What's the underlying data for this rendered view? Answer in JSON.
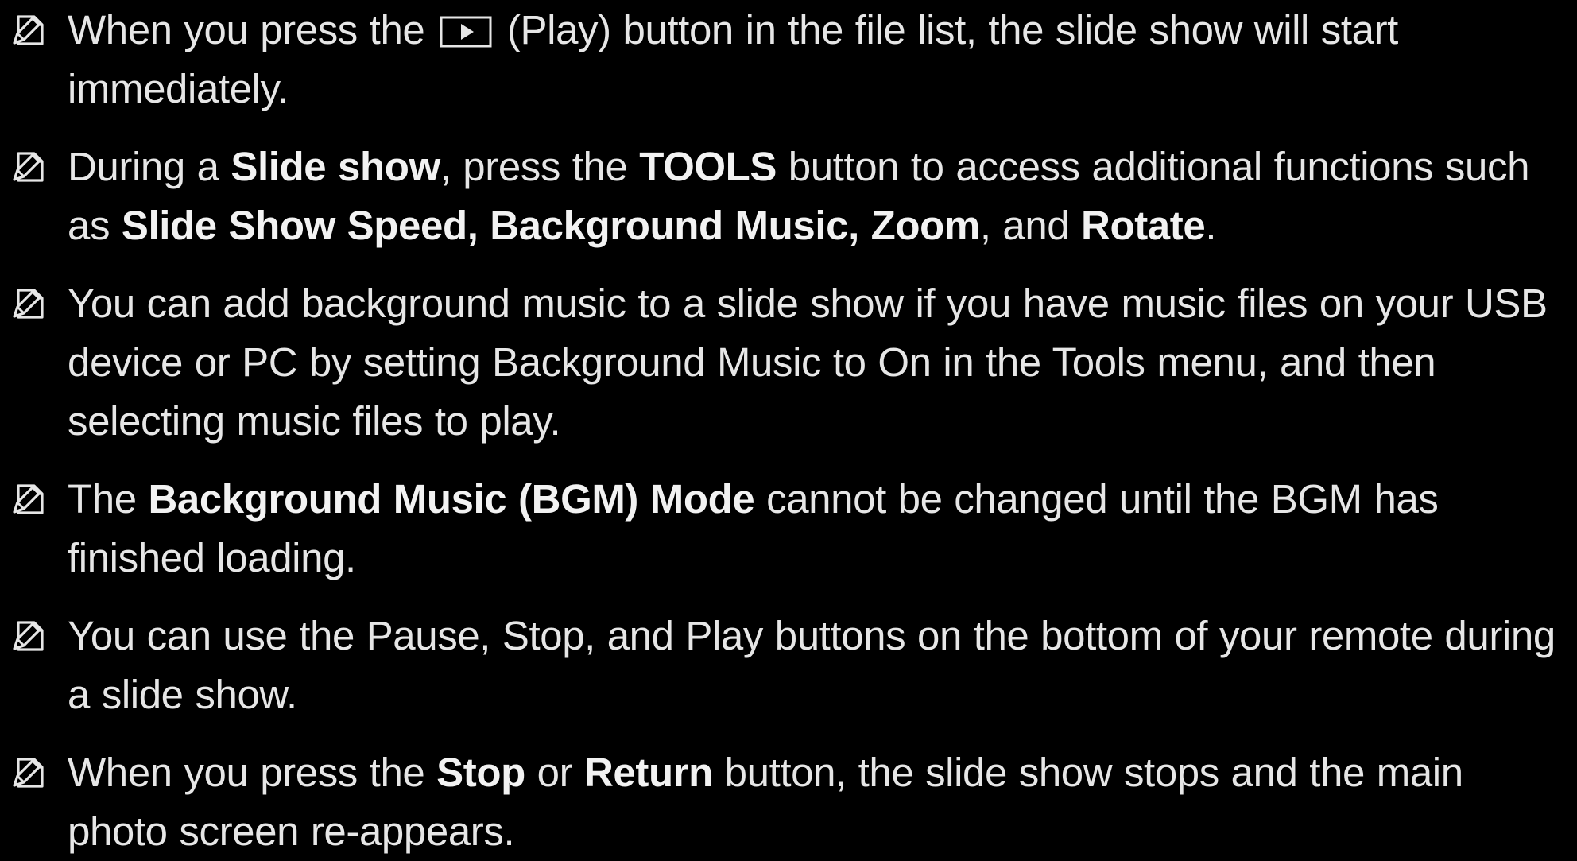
{
  "icons": {
    "note": "note-icon",
    "play": "play-button-icon"
  },
  "colors": {
    "background": "#000000",
    "text": "#e6e6e6"
  },
  "notes": [
    {
      "before_icon": "When you press the",
      "after_icon": "(Play) button in the file list, the slide show will start immediately."
    },
    {
      "t1": "During a ",
      "b1": "Slide show",
      "t2": ", press the ",
      "b2": "TOOLS",
      "t3": " button to access additional functions such as ",
      "b3": "Slide Show Speed, Background Music, Zoom",
      "t4": ", and ",
      "b4": "Rotate",
      "t5": "."
    },
    {
      "text": "You can add background music to a slide show if you have music files on your USB device or PC by setting Background Music to On in the Tools menu, and then selecting music files to play."
    },
    {
      "t1": "The ",
      "b1": "Background Music (BGM) Mode",
      "t2": " cannot be changed until the BGM has finished loading."
    },
    {
      "text": "You can use the Pause, Stop, and Play buttons on the bottom of your remote during a slide show."
    },
    {
      "t1": "When you press the ",
      "b1": "Stop",
      "t2": " or ",
      "b2": "Return",
      "t3": " button, the slide show stops and the main photo screen re-appears."
    }
  ]
}
